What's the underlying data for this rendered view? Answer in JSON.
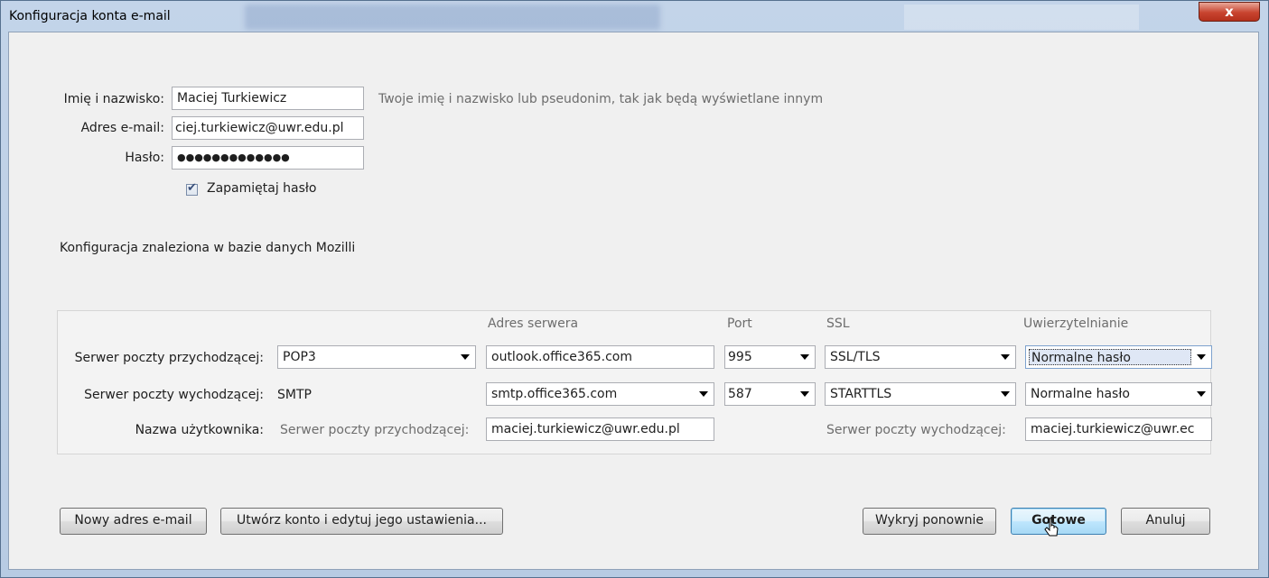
{
  "window": {
    "title": "Konfiguracja konta e-mail",
    "close_glyph": "x"
  },
  "identity": {
    "name_label": "Imię i nazwisko:",
    "name_value": "Maciej Turkiewicz",
    "name_hint": "Twoje imię i nazwisko lub pseudonim, tak jak będą wyświetlane innym",
    "email_label": "Adres e-mail:",
    "email_value": "ciej.turkiewicz@uwr.edu.pl",
    "password_label": "Hasło:",
    "password_value": "●●●●●●●●●●●●●",
    "remember_label": "Zapamiętaj hasło",
    "remember_checked": true
  },
  "status_text": "Konfiguracja znaleziona w bazie danych Mozilli",
  "server_table": {
    "headers": {
      "server_address": "Adres serwera",
      "port": "Port",
      "ssl": "SSL",
      "auth": "Uwierzytelnianie"
    },
    "incoming": {
      "label": "Serwer poczty przychodzącej:",
      "protocol": "POP3",
      "address": "outlook.office365.com",
      "port": "995",
      "ssl": "SSL/TLS",
      "auth": "Normalne hasło"
    },
    "outgoing": {
      "label": "Serwer poczty wychodzącej:",
      "protocol": "SMTP",
      "address": "smtp.office365.com",
      "port": "587",
      "ssl": "STARTTLS",
      "auth": "Normalne hasło"
    },
    "username": {
      "label": "Nazwa użytkownika:",
      "incoming_label": "Serwer poczty przychodzącej:",
      "incoming_value": "maciej.turkiewicz@uwr.edu.pl",
      "outgoing_label": "Serwer poczty wychodzącej:",
      "outgoing_value": "maciej.turkiewicz@uwr.ec"
    }
  },
  "buttons": {
    "new_email": "Nowy adres e-mail",
    "create_edit": "Utwórz konto i edytuj jego ustawienia...",
    "redetect": "Wykryj ponownie",
    "done": "Gotowe",
    "cancel": "Anuluj"
  },
  "colors": {
    "close_button": "#c8442f",
    "default_button_border": "#3c7fb1",
    "hint_text": "#6d6d6d"
  }
}
